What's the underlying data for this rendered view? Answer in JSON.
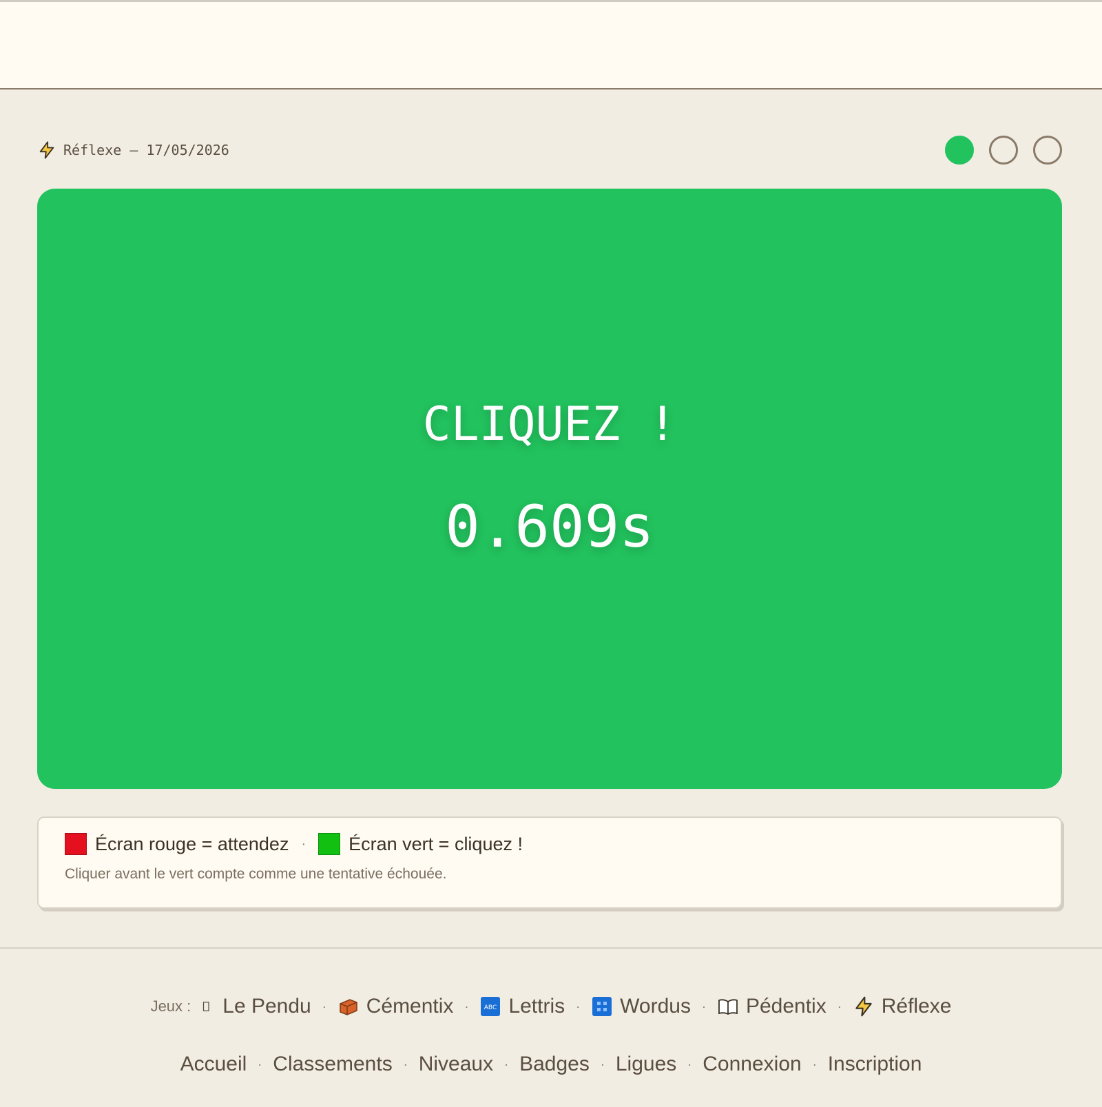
{
  "game": {
    "title": "Réflexe — 17/05/2026",
    "attempts_filled": 1,
    "attempts_total": 3
  },
  "play": {
    "message": "CLIQUEZ !",
    "time": "0.609s",
    "color": "#22c35e"
  },
  "rules": {
    "red_label": "Écran rouge = attendez",
    "green_label": "Écran vert = cliquez !",
    "note": "Cliquer avant le vert compte comme une tentative échouée.",
    "red_color": "#e5101f",
    "green_color": "#12c012"
  },
  "footer": {
    "games_label": "Jeux :",
    "games": [
      {
        "label": "Le Pendu",
        "icon": "placeholder-box-icon"
      },
      {
        "label": "Cémentix",
        "icon": "brick-icon"
      },
      {
        "label": "Lettris",
        "icon": "letters-tile-icon"
      },
      {
        "label": "Wordus",
        "icon": "grid-tile-icon"
      },
      {
        "label": "Pédentix",
        "icon": "open-book-icon"
      },
      {
        "label": "Réflexe",
        "icon": "lightning-bolt-icon"
      }
    ],
    "nav": [
      "Accueil",
      "Classements",
      "Niveaux",
      "Badges",
      "Ligues",
      "Connexion",
      "Inscription"
    ]
  }
}
